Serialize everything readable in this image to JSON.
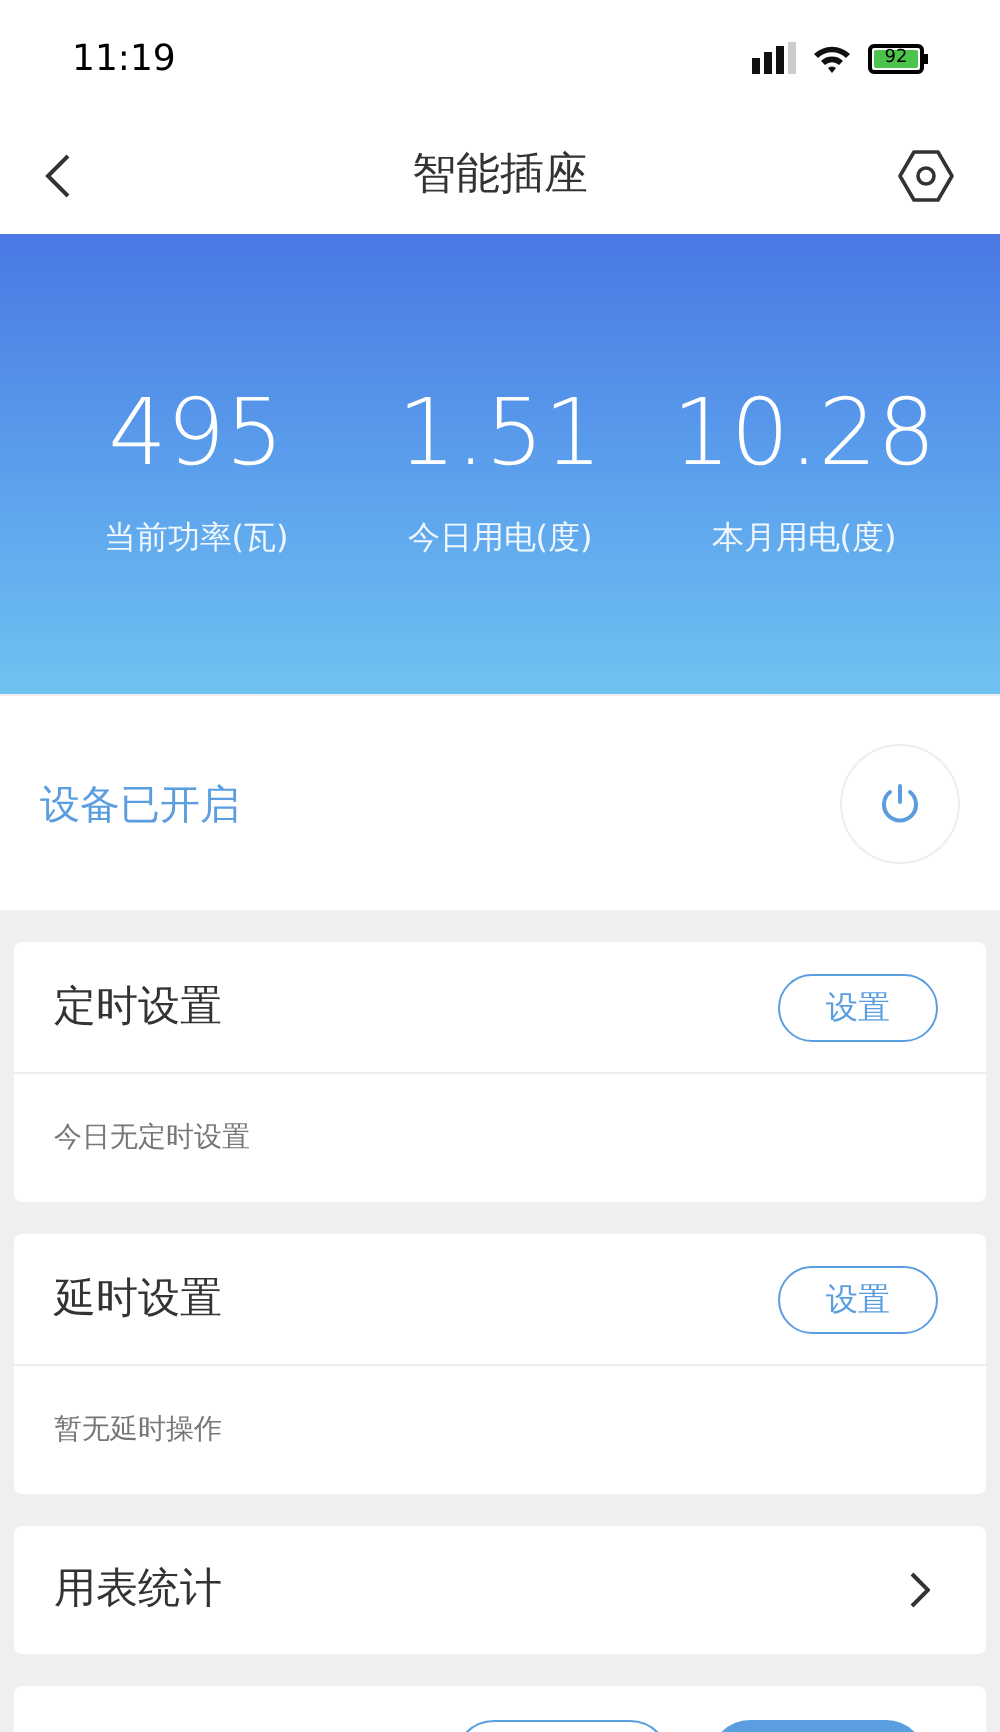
{
  "status_bar": {
    "time": "11:19",
    "battery": "92"
  },
  "nav": {
    "title": "智能插座"
  },
  "stats": [
    {
      "value": "495",
      "label": "当前功率(瓦)"
    },
    {
      "value": "1.51",
      "label": "今日用电(度)"
    },
    {
      "value": "10.28",
      "label": "本月用电(度)"
    }
  ],
  "device": {
    "status": "设备已开启",
    "on": true
  },
  "sections": [
    {
      "kind": "setting",
      "title": "定时设置",
      "button": "设置",
      "note": "今日无定时设置"
    },
    {
      "kind": "setting",
      "title": "延时设置",
      "button": "设置",
      "note": "暂无延时操作"
    },
    {
      "kind": "link",
      "title": "用表统计"
    }
  ]
}
